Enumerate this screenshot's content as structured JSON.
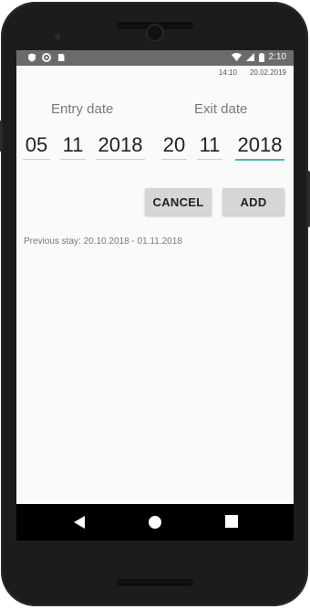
{
  "statusbar": {
    "time": "2:10",
    "icons": [
      "shield-icon",
      "gear-icon",
      "sim-card-icon",
      "wifi-icon",
      "signal-icon",
      "battery-icon"
    ]
  },
  "stamp": {
    "time": "14:10",
    "date": "20.02.2019"
  },
  "entry": {
    "label": "Entry date",
    "day": "05",
    "month": "11",
    "year": "2018"
  },
  "exit": {
    "label": "Exit date",
    "day": "20",
    "month": "11",
    "year": "2018"
  },
  "buttons": {
    "cancel": "CANCEL",
    "add": "ADD"
  },
  "previous_stay": "Previous stay: 20.10.2018 - 01.11.2018",
  "nav": {
    "icons": [
      "back-icon",
      "home-icon",
      "recents-icon"
    ]
  },
  "colors": {
    "accent": "#4db6ac",
    "statusbar": "#6b6b6b",
    "button": "#d6d6d6"
  }
}
